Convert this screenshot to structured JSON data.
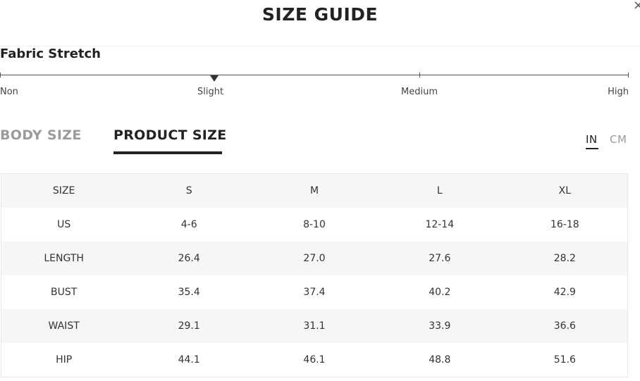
{
  "modal": {
    "title": "SIZE GUIDE",
    "close_glyph": "×"
  },
  "fabric_stretch": {
    "title": "Fabric Stretch",
    "levels": [
      "Non",
      "Slight",
      "Medium",
      "High"
    ],
    "selected": "Slight"
  },
  "tabs": [
    {
      "label": "BODY SIZE",
      "active": false
    },
    {
      "label": "PRODUCT SIZE",
      "active": true
    }
  ],
  "units": [
    {
      "label": "IN",
      "active": true
    },
    {
      "label": "CM",
      "active": false
    }
  ],
  "size_table": {
    "header": [
      "SIZE",
      "S",
      "M",
      "L",
      "XL"
    ],
    "rows": [
      [
        "US",
        "4-6",
        "8-10",
        "12-14",
        "16-18"
      ],
      [
        "LENGTH",
        "26.4",
        "27.0",
        "27.6",
        "28.2"
      ],
      [
        "BUST",
        "35.4",
        "37.4",
        "40.2",
        "42.9"
      ],
      [
        "WAIST",
        "29.1",
        "31.1",
        "33.9",
        "36.6"
      ],
      [
        "HIP",
        "44.1",
        "46.1",
        "48.8",
        "51.6"
      ]
    ]
  }
}
